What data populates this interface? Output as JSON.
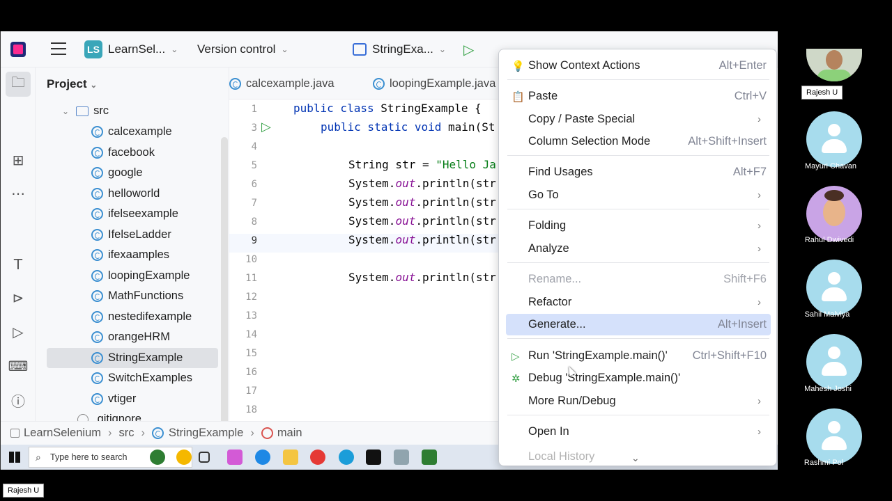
{
  "titlebar": {
    "project_badge": "LS",
    "project_name": "LearnSel...",
    "vcs": "Version control",
    "run_config": "StringExa..."
  },
  "project_panel": {
    "title": "Project",
    "items": [
      {
        "label": "src",
        "type": "folder"
      },
      {
        "label": "calcexample",
        "type": "class"
      },
      {
        "label": "facebook",
        "type": "class"
      },
      {
        "label": "google",
        "type": "class"
      },
      {
        "label": "helloworld",
        "type": "class"
      },
      {
        "label": "ifelseexample",
        "type": "class"
      },
      {
        "label": "IfelseLadder",
        "type": "class"
      },
      {
        "label": "ifexaamples",
        "type": "class"
      },
      {
        "label": "loopingExample",
        "type": "class"
      },
      {
        "label": "MathFunctions",
        "type": "class"
      },
      {
        "label": "nestedifexample",
        "type": "class"
      },
      {
        "label": "orangeHRM",
        "type": "class"
      },
      {
        "label": "StringExample",
        "type": "class",
        "selected": true
      },
      {
        "label": "SwitchExamples",
        "type": "class"
      },
      {
        "label": "vtiger",
        "type": "class"
      },
      {
        "label": ".gitignore",
        "type": "file"
      }
    ]
  },
  "tabs": [
    {
      "label": "calcexample.java"
    },
    {
      "label": "loopingExample.java"
    }
  ],
  "editor": {
    "line_numbers": [
      "1",
      "3",
      "4",
      "5",
      "6",
      "7",
      "8",
      "9",
      "10",
      "11",
      "12",
      "13",
      "14",
      "15",
      "16",
      "17",
      "18"
    ],
    "line1": {
      "kw": "public class ",
      "rest": "StringExample {"
    },
    "line3": {
      "kw": "public static void ",
      "rest": "main(St"
    },
    "line5": {
      "pre": "String str = ",
      "str": "\"Hello Ja"
    },
    "println_pre": "System.",
    "println_out": "out",
    "println_post": ".println(str"
  },
  "statusbar": {
    "crumbs": [
      "LearnSelenium",
      "src",
      "StringExample",
      "main"
    ]
  },
  "context_menu": {
    "items": [
      {
        "label": "Show Context Actions",
        "shortcut": "Alt+Enter"
      },
      {
        "label": "Paste",
        "shortcut": "Ctrl+V"
      },
      {
        "label": "Copy / Paste Special",
        "shortcut": ""
      },
      {
        "label": "Column Selection Mode",
        "shortcut": "Alt+Shift+Insert"
      },
      {
        "label": "Find Usages",
        "shortcut": "Alt+F7"
      },
      {
        "label": "Go To",
        "shortcut": ""
      },
      {
        "label": "Folding",
        "shortcut": ""
      },
      {
        "label": "Analyze",
        "shortcut": ""
      },
      {
        "label": "Rename...",
        "shortcut": "Shift+F6"
      },
      {
        "label": "Refactor",
        "shortcut": ""
      },
      {
        "label": "Generate...",
        "shortcut": "Alt+Insert"
      },
      {
        "label": "Run 'StringExample.main()'",
        "shortcut": "Ctrl+Shift+F10"
      },
      {
        "label": "Debug 'StringExample.main()'",
        "shortcut": ""
      },
      {
        "label": "More Run/Debug",
        "shortcut": ""
      },
      {
        "label": "Open In",
        "shortcut": ""
      },
      {
        "label": "Local History",
        "shortcut": ""
      }
    ]
  },
  "taskbar": {
    "search_placeholder": "Type here to search"
  },
  "participants": [
    {
      "name": "Rajesh U"
    },
    {
      "name": "Mayuri Chavan"
    },
    {
      "name": "Rahul Dwivedi"
    },
    {
      "name": "Sahil Malviya"
    },
    {
      "name": "Mahesh Joshi"
    },
    {
      "name": "Rashmi Pol"
    }
  ],
  "presenter_label": "Rajesh U",
  "colors": {
    "accent": "#3574f0",
    "highlight": "#d5e1fb",
    "keyword": "#0033b3",
    "string": "#067d17"
  }
}
